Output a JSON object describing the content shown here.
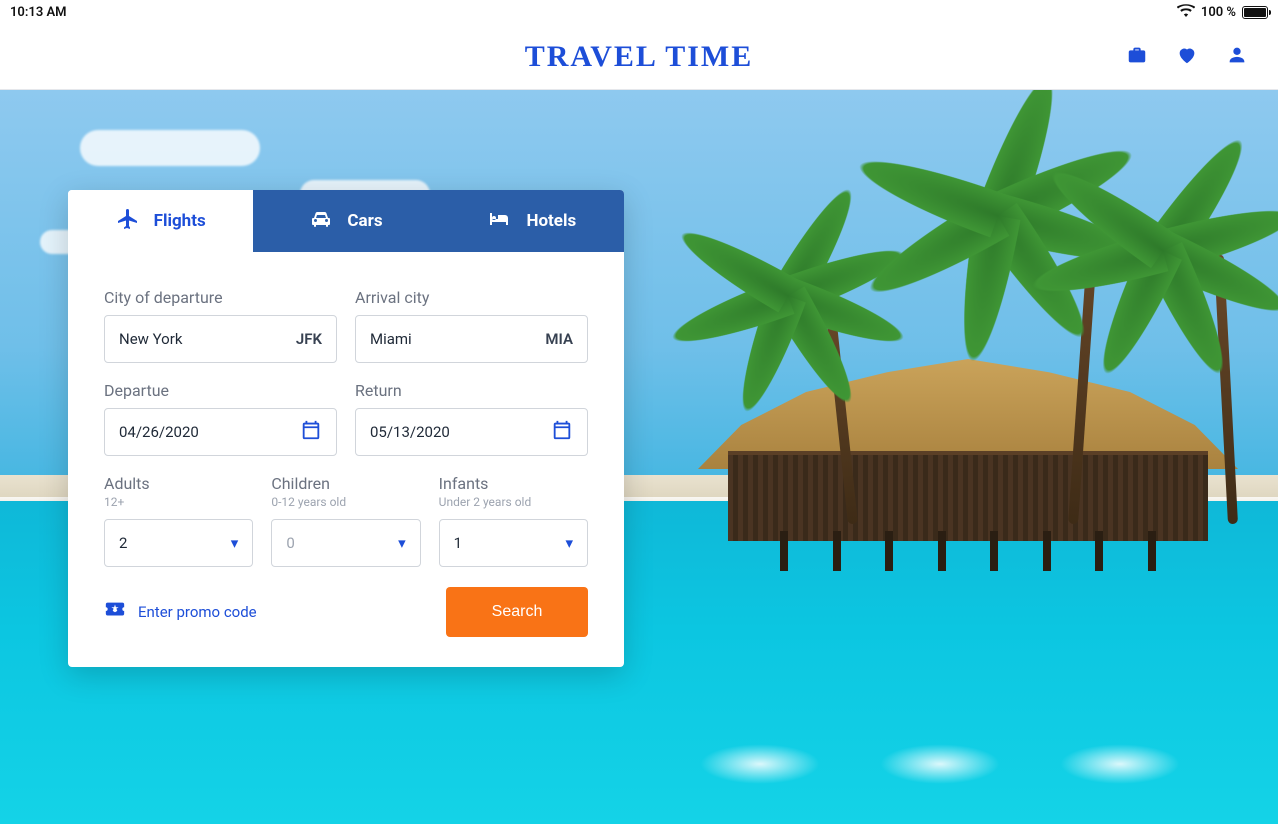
{
  "statusbar": {
    "time": "10:13 AM",
    "battery_pct": "100 %"
  },
  "header": {
    "brand": "Travel Time"
  },
  "search": {
    "tabs": {
      "flights": "Flights",
      "cars": "Cars",
      "hotels": "Hotels"
    },
    "labels": {
      "departure_city": "City of departure",
      "arrival_city": "Arrival city",
      "departure": "Departue",
      "return": "Return",
      "adults": "Adults",
      "adults_sub": "12+",
      "children": "Children",
      "children_sub": "0-12 years old",
      "infants": "Infants",
      "infants_sub": "Under 2 years old"
    },
    "values": {
      "from_city": "New York",
      "from_code": "JFK",
      "to_city": "Miami",
      "to_code": "MIA",
      "depart_date": "04/26/2020",
      "return_date": "05/13/2020",
      "adults": "2",
      "children": "0",
      "infants": "1"
    },
    "promo": "Enter promo code",
    "search_btn": "Search"
  }
}
